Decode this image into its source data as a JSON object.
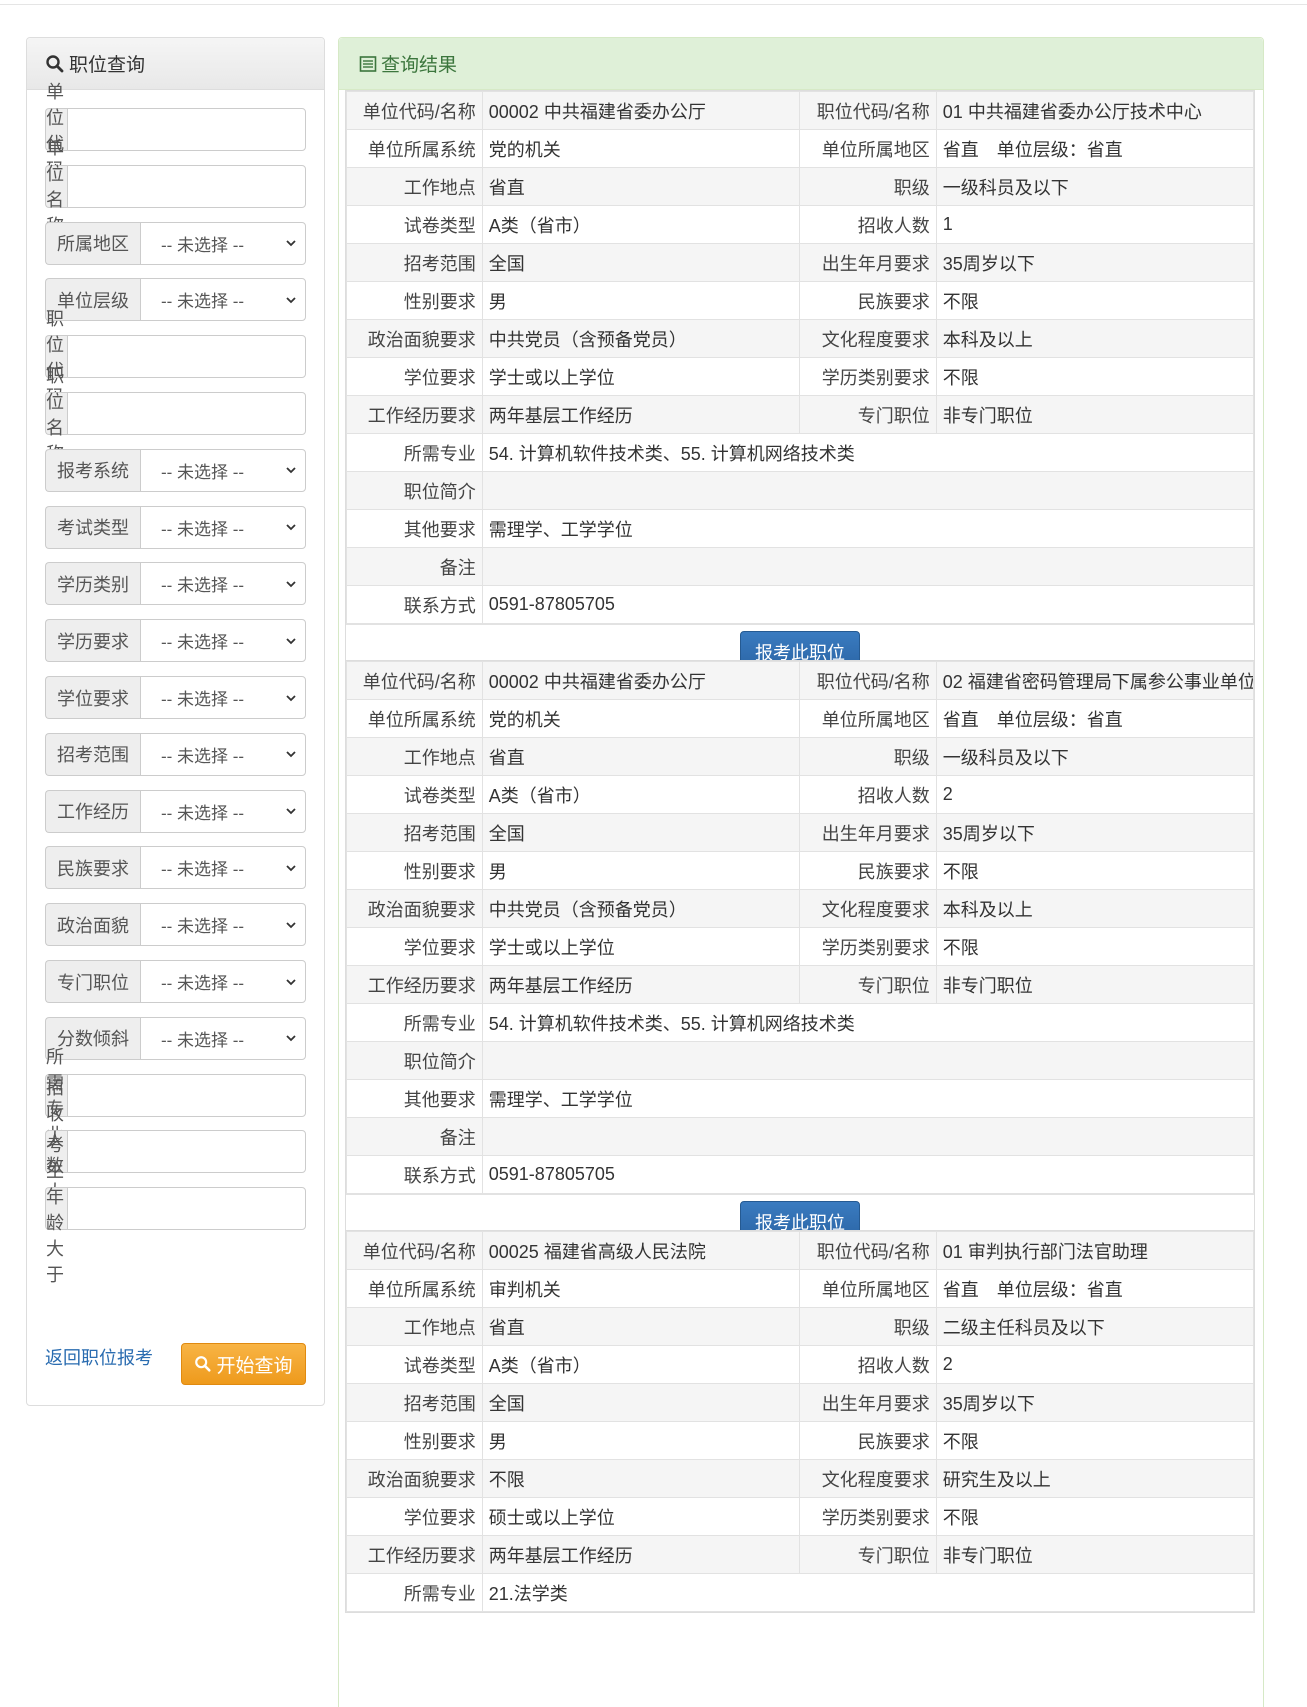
{
  "sidebar": {
    "title": "职位查询",
    "fields": [
      {
        "label": "单位代码",
        "type": "input",
        "value": ""
      },
      {
        "label": "单位名称",
        "type": "input",
        "value": ""
      },
      {
        "label": "所属地区",
        "type": "select",
        "value": "-- 未选择 --"
      },
      {
        "label": "单位层级",
        "type": "select",
        "value": "-- 未选择 --"
      },
      {
        "label": "职位代码",
        "type": "input",
        "value": ""
      },
      {
        "label": "职位名称",
        "type": "input",
        "value": ""
      },
      {
        "label": "报考系统",
        "type": "select",
        "value": "-- 未选择 --"
      },
      {
        "label": "考试类型",
        "type": "select",
        "value": "-- 未选择 --"
      },
      {
        "label": "学历类别",
        "type": "select",
        "value": "-- 未选择 --"
      },
      {
        "label": "学历要求",
        "type": "select",
        "value": "-- 未选择 --"
      },
      {
        "label": "学位要求",
        "type": "select",
        "value": "-- 未选择 --"
      },
      {
        "label": "招考范围",
        "type": "select",
        "value": "-- 未选择 --"
      },
      {
        "label": "工作经历",
        "type": "select",
        "value": "-- 未选择 --"
      },
      {
        "label": "民族要求",
        "type": "select",
        "value": "-- 未选择 --"
      },
      {
        "label": "政治面貌",
        "type": "select",
        "value": "-- 未选择 --"
      },
      {
        "label": "专门职位",
        "type": "select",
        "value": "-- 未选择 --"
      },
      {
        "label": "分数倾斜",
        "type": "select",
        "value": "-- 未选择 --"
      },
      {
        "label": "所需专业",
        "type": "input",
        "value": ""
      },
      {
        "label": "招收人数大于",
        "type": "input",
        "value": ""
      },
      {
        "label": "考生年龄大于",
        "type": "input",
        "value": ""
      }
    ],
    "back_link": "返回职位报考",
    "search_button": "开始查询"
  },
  "results": {
    "title": "查询结果",
    "apply_label": "报考此职位",
    "items": [
      {
        "pairs": [
          [
            "单位代码/名称",
            "00002 中共福建省委办公厅",
            "职位代码/名称",
            "01 中共福建省委办公厅技术中心"
          ],
          [
            "单位所属系统",
            "党的机关",
            "单位所属地区",
            "省直　单位层级：省直"
          ],
          [
            "工作地点",
            "省直",
            "职级",
            "一级科员及以下"
          ],
          [
            "试卷类型",
            "A类（省市）",
            "招收人数",
            "1"
          ],
          [
            "招考范围",
            "全国",
            "出生年月要求",
            "35周岁以下"
          ],
          [
            "性别要求",
            "男",
            "民族要求",
            "不限"
          ],
          [
            "政治面貌要求",
            "中共党员（含预备党员）",
            "文化程度要求",
            "本科及以上"
          ],
          [
            "学位要求",
            "学士或以上学位",
            "学历类别要求",
            "不限"
          ],
          [
            "工作经历要求",
            "两年基层工作经历",
            "专门职位",
            "非专门职位"
          ]
        ],
        "wide": [
          [
            "所需专业",
            "54. 计算机软件技术类、55. 计算机网络技术类"
          ],
          [
            "职位简介",
            ""
          ],
          [
            "其他要求",
            "需理学、工学学位"
          ],
          [
            "备注",
            ""
          ],
          [
            "联系方式",
            "0591-87805705"
          ]
        ]
      },
      {
        "pairs": [
          [
            "单位代码/名称",
            "00002 中共福建省委办公厅",
            "职位代码/名称",
            "02 福建省密码管理局下属参公事业单位"
          ],
          [
            "单位所属系统",
            "党的机关",
            "单位所属地区",
            "省直　单位层级：省直"
          ],
          [
            "工作地点",
            "省直",
            "职级",
            "一级科员及以下"
          ],
          [
            "试卷类型",
            "A类（省市）",
            "招收人数",
            "2"
          ],
          [
            "招考范围",
            "全国",
            "出生年月要求",
            "35周岁以下"
          ],
          [
            "性别要求",
            "男",
            "民族要求",
            "不限"
          ],
          [
            "政治面貌要求",
            "中共党员（含预备党员）",
            "文化程度要求",
            "本科及以上"
          ],
          [
            "学位要求",
            "学士或以上学位",
            "学历类别要求",
            "不限"
          ],
          [
            "工作经历要求",
            "两年基层工作经历",
            "专门职位",
            "非专门职位"
          ]
        ],
        "wide": [
          [
            "所需专业",
            "54. 计算机软件技术类、55. 计算机网络技术类"
          ],
          [
            "职位简介",
            ""
          ],
          [
            "其他要求",
            "需理学、工学学位"
          ],
          [
            "备注",
            ""
          ],
          [
            "联系方式",
            "0591-87805705"
          ]
        ]
      },
      {
        "pairs": [
          [
            "单位代码/名称",
            "00025 福建省高级人民法院",
            "职位代码/名称",
            "01 审判执行部门法官助理"
          ],
          [
            "单位所属系统",
            "审判机关",
            "单位所属地区",
            "省直　单位层级：省直"
          ],
          [
            "工作地点",
            "省直",
            "职级",
            "二级主任科员及以下"
          ],
          [
            "试卷类型",
            "A类（省市）",
            "招收人数",
            "2"
          ],
          [
            "招考范围",
            "全国",
            "出生年月要求",
            "35周岁以下"
          ],
          [
            "性别要求",
            "男",
            "民族要求",
            "不限"
          ],
          [
            "政治面貌要求",
            "不限",
            "文化程度要求",
            "研究生及以上"
          ],
          [
            "学位要求",
            "硕士或以上学位",
            "学历类别要求",
            "不限"
          ],
          [
            "工作经历要求",
            "两年基层工作经历",
            "专门职位",
            "非专门职位"
          ]
        ],
        "wide": [
          [
            "所需专业",
            "21.法学类"
          ]
        ]
      }
    ]
  }
}
